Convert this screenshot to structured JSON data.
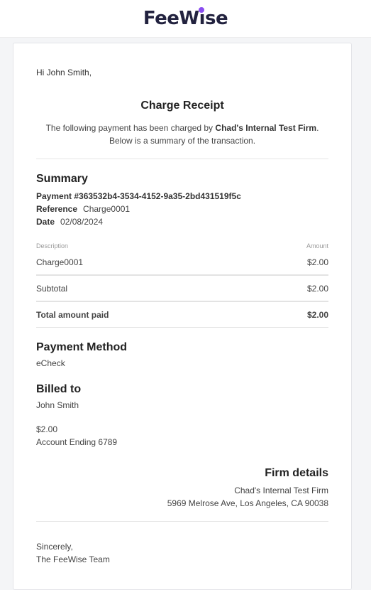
{
  "brand": {
    "name_part1": "FeeW",
    "name_part2": "ıse",
    "accent_color": "#8a4df0"
  },
  "greeting": "Hi John Smith,",
  "receipt": {
    "title": "Charge Receipt",
    "intro_prefix": "The following payment has been charged by ",
    "firm_name": "Chad's Internal Test Firm",
    "intro_suffix": ".",
    "intro_line2": "Below is a summary of the transaction."
  },
  "summary": {
    "heading": "Summary",
    "payment_label": "Payment #363532b4-3534-4152-9a35-2bd431519f5c",
    "reference_label": "Reference",
    "reference_value": "Charge0001",
    "date_label": "Date",
    "date_value": "02/08/2024",
    "table": {
      "col_description": "Description",
      "col_amount": "Amount",
      "item_description": "Charge0001",
      "item_amount": "$2.00",
      "subtotal_label": "Subtotal",
      "subtotal_amount": "$2.00",
      "total_label": "Total amount paid",
      "total_amount": "$2.00"
    }
  },
  "payment_method": {
    "heading": "Payment Method",
    "value": "eCheck"
  },
  "billed_to": {
    "heading": "Billed to",
    "name": "John Smith",
    "amount": "$2.00",
    "account": "Account Ending 6789"
  },
  "firm_details": {
    "heading": "Firm details",
    "name": "Chad's Internal Test Firm",
    "address": "5969 Melrose Ave, Los Angeles, CA 90038"
  },
  "closing": {
    "line1": "Sincerely,",
    "line2": "The FeeWise Team"
  }
}
